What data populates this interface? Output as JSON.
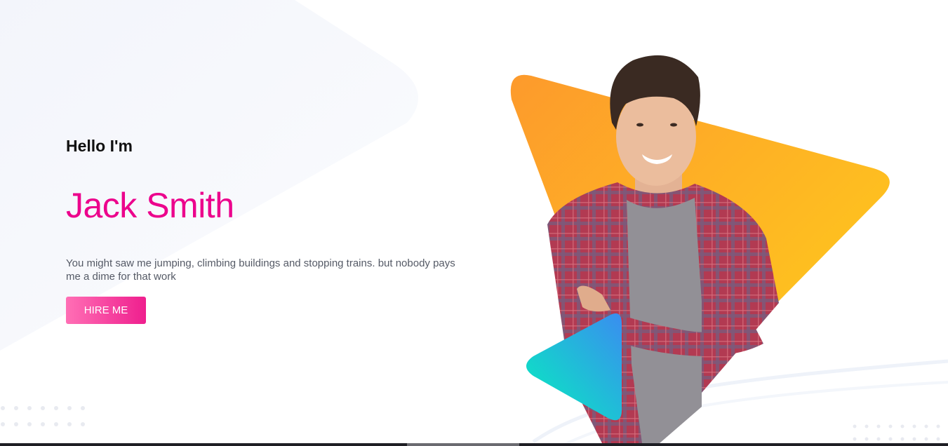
{
  "hero": {
    "greeting": "Hello I'm",
    "name": "Jack Smith",
    "description": "You might saw me jumping, climbing buildings and stopping trains. but nobody pays me a dime for that work",
    "cta_label": "HIRE ME"
  },
  "colors": {
    "accent": "#ec008c",
    "button_start": "#ff6fb5",
    "button_end": "#ef1f8e",
    "orange_start": "#fd9a2c",
    "orange_end": "#ffd21a",
    "teal_start": "#05efbe",
    "teal_end": "#3a8df0"
  },
  "icons": {
    "big_triangle": "play-triangle-icon",
    "small_triangle": "play-triangle-icon"
  }
}
